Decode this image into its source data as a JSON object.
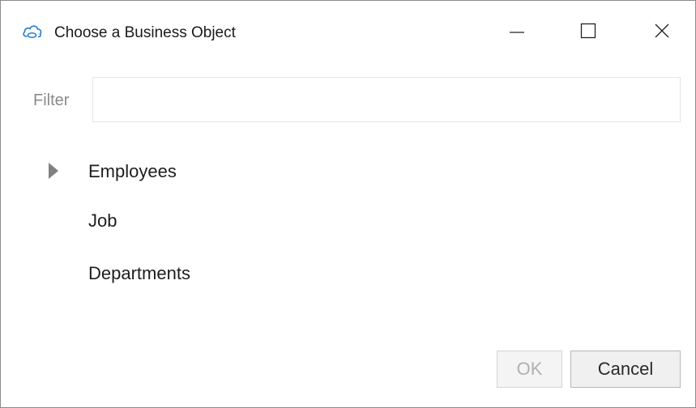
{
  "window": {
    "title": "Choose a Business Object",
    "app_icon": "cloud-icon"
  },
  "title_controls": {
    "minimize_icon": "minimize-icon",
    "maximize_icon": "maximize-icon",
    "close_icon": "close-icon"
  },
  "filter": {
    "label": "Filter",
    "value": "",
    "placeholder": ""
  },
  "tree": {
    "items": [
      {
        "label": "Employees",
        "expandable": true
      },
      {
        "label": "Job",
        "expandable": false
      },
      {
        "label": "Departments",
        "expandable": false
      }
    ]
  },
  "footer": {
    "ok_label": "OK",
    "ok_enabled": false,
    "cancel_label": "Cancel"
  },
  "colors": {
    "accent": "#1f7ecf",
    "disabled_text": "#b0b0b0",
    "label_muted": "#8a8a8a"
  }
}
